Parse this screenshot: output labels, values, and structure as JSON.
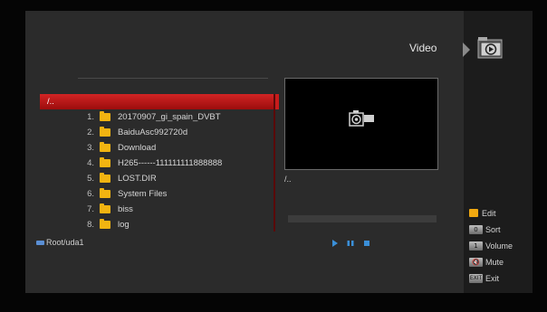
{
  "header": {
    "section_title": "Video",
    "section_icon": "video-folder-icon"
  },
  "file_list": {
    "selected": {
      "label": "/.."
    },
    "items": [
      {
        "index": "1.",
        "name": "20170907_gi_spain_DVBT",
        "icon": "folder-icon"
      },
      {
        "index": "2.",
        "name": "BaiduAsc992720d",
        "icon": "folder-icon"
      },
      {
        "index": "3.",
        "name": "Download",
        "icon": "folder-icon"
      },
      {
        "index": "4.",
        "name": "H265------111111111888888",
        "icon": "folder-icon"
      },
      {
        "index": "5.",
        "name": "LOST.DIR",
        "icon": "folder-icon"
      },
      {
        "index": "6.",
        "name": "System Files",
        "icon": "folder-icon"
      },
      {
        "index": "7.",
        "name": "biss",
        "icon": "folder-icon"
      },
      {
        "index": "8.",
        "name": "log",
        "icon": "folder-icon"
      }
    ],
    "path": "Root/uda1"
  },
  "preview": {
    "current_path": "/..",
    "progress": 0
  },
  "controls": [
    "play-icon",
    "pause-icon",
    "stop-icon"
  ],
  "legend": {
    "edit": {
      "key": "",
      "label": "Edit"
    },
    "sort": {
      "key": "0",
      "label": "Sort"
    },
    "volume": {
      "key": "1",
      "label": "Volume"
    },
    "mute": {
      "key": "🔇",
      "label": "Mute"
    },
    "exit": {
      "key": "EXIT",
      "label": "Exit"
    }
  },
  "colors": {
    "selection": "#c81c1c",
    "folder": "#f2b411",
    "controls": "#3a8fd8",
    "edit_key": "#f0a810"
  }
}
